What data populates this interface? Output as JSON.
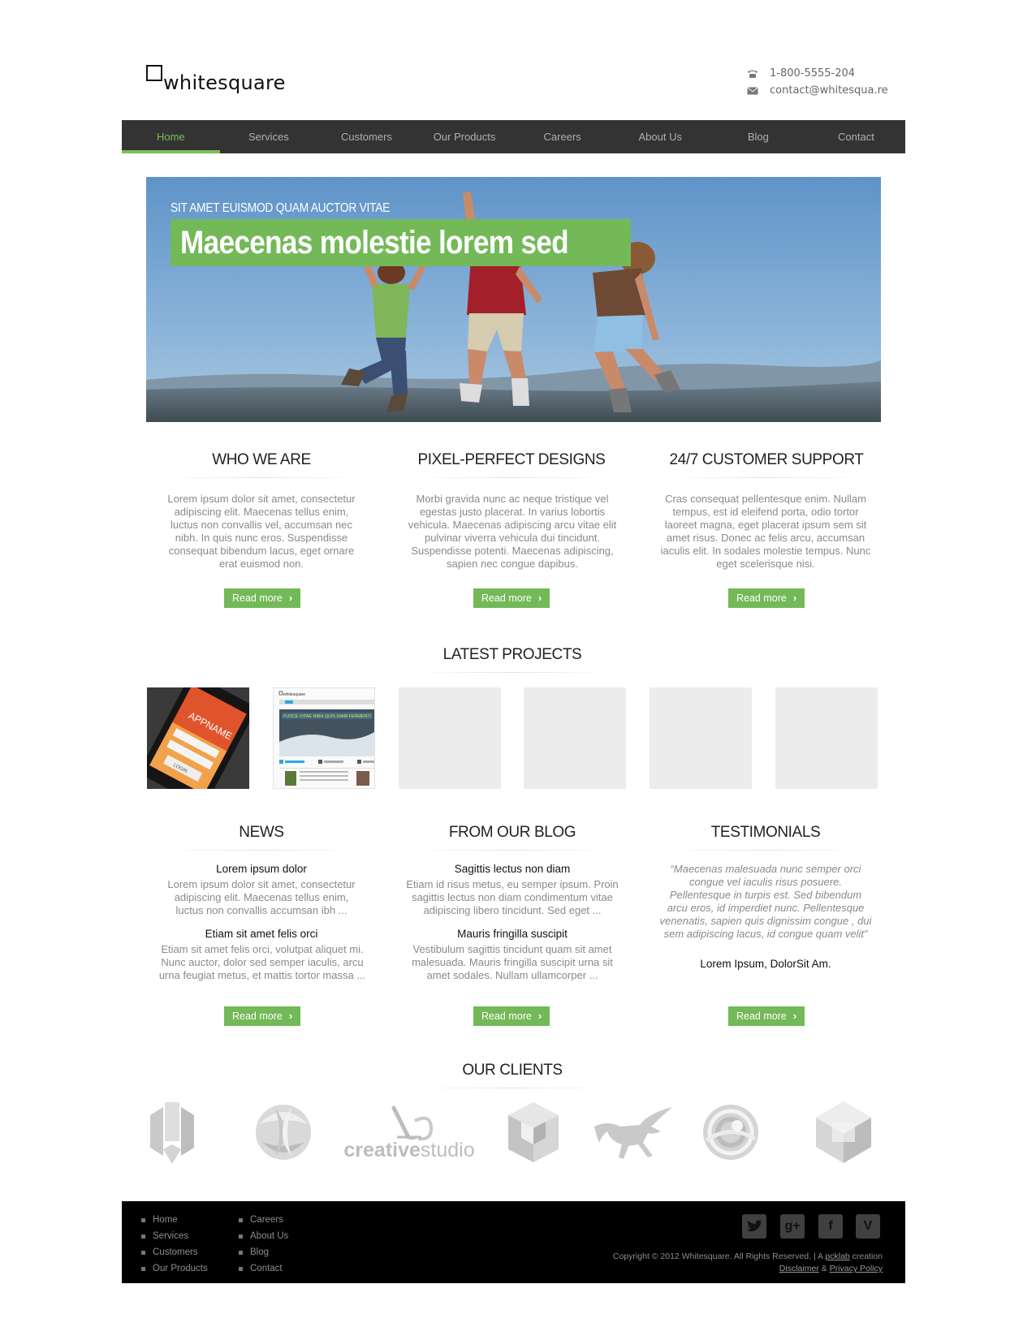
{
  "brand": {
    "name": "whitesquare"
  },
  "contact": {
    "phone": "1-800-5555-204",
    "email": "contact@whitesqua.re",
    "phone_icon": "phone-icon",
    "email_icon": "envelope-icon"
  },
  "nav": {
    "items": [
      {
        "label": "Home",
        "active": true
      },
      {
        "label": "Services"
      },
      {
        "label": "Customers"
      },
      {
        "label": "Our Products"
      },
      {
        "label": "Careers"
      },
      {
        "label": "About Us"
      },
      {
        "label": "Blog"
      },
      {
        "label": "Contact"
      }
    ]
  },
  "hero": {
    "subtitle": "SIT AMET EUISMOD QUAM AUCTOR VITAE",
    "title": "Maecenas molestie lorem sed"
  },
  "features": [
    {
      "title": "WHO WE ARE",
      "text": "Lorem ipsum dolor sit amet, consectetur adipiscing elit. Maecenas tellus enim, luctus non convallis vel, accumsan nec nibh. In quis nunc eros. Suspendisse consequat bibendum lacus, eget ornare erat euismod non.",
      "button": "Read more"
    },
    {
      "title": "PIXEL-PERFECT DESIGNS",
      "text": "Morbi gravida nunc ac neque tristique vel egestas justo placerat. In varius lobortis vehicula. Maecenas adipiscing arcu vitae elit pulvinar viverra vehicula dui tincidunt. Suspendisse potenti. Maecenas adipiscing, sapien nec congue dapibus.",
      "button": "Read more"
    },
    {
      "title": "24/7 CUSTOMER SUPPORT",
      "text": "Cras consequat pellentesque enim. Nullam tempus, est id eleifend porta, odio tortor laoreet magna, eget placerat ipsum sem sit amet risus. Donec ac felis arcu, accumsan iaculis elit. In sodales molestie tempus. Nunc eget scelerisque nisi.",
      "button": "Read more"
    }
  ],
  "projects": {
    "title": "LATEST PROJECTS",
    "thumb1": {
      "screen_text": "APPNAME",
      "login": "LOGIN"
    },
    "thumb2": {
      "brand": "whitesquare",
      "banner": "FUSCE VITAE NIBH QUIS DIAM FERMENTI"
    }
  },
  "news": {
    "title": "NEWS",
    "items": [
      {
        "title": "Lorem ipsum dolor",
        "text": "Lorem ipsum dolor sit amet, consectetur adipiscing elit. Maecenas tellus enim, luctus non convallis accumsan ibh ..."
      },
      {
        "title": "Etiam sit amet felis orci",
        "text": "Etiam sit amet felis orci, volutpat aliquet mi. Nunc auctor, dolor sed semper iaculis, arcu urna feugiat metus, et mattis tortor massa ..."
      }
    ],
    "button": "Read more"
  },
  "blog": {
    "title": "FROM OUR BLOG",
    "items": [
      {
        "title": "Sagittis lectus non diam",
        "text": "Etiam id risus metus, eu semper ipsum. Proin sagittis lectus non diam condimentum vitae adipiscing libero tincidunt. Sed eget ..."
      },
      {
        "title": "Mauris fringilla suscipit",
        "text": "Vestibulum sagittis tincidunt quam sit amet malesuada. Mauris fringilla suscipit urna sit amet sodales. Nullam ullamcorper ..."
      }
    ],
    "button": "Read more"
  },
  "testimonials": {
    "title": "TESTIMONIALS",
    "quote": "“Maecenas malesuada nunc semper orci congue vel iaculis risus posuere. Pellentesque in turpis est. Sed bibendum arcu eros, id imperdiet nunc. Pellentesque venenatis, sapien quis dignissim congue , dui sem adipiscing lacus, id congue quam velit”",
    "author": "Lorem Ipsum, DolorSit Am.",
    "button": "Read more"
  },
  "clients": {
    "title": "OUR CLIENTS",
    "creative_bold": "creative",
    "creative_light": "studio"
  },
  "footer": {
    "col1": [
      "Home",
      "Services",
      "Customers",
      "Our Products"
    ],
    "col2": [
      "Careers",
      "About Us",
      "Blog",
      "Contact"
    ],
    "social": [
      {
        "icon": "twitter-icon"
      },
      {
        "icon": "google-plus-icon",
        "glyph": "g+"
      },
      {
        "icon": "facebook-icon",
        "glyph": "f"
      },
      {
        "icon": "vimeo-icon",
        "glyph": "V"
      }
    ],
    "copyright": "Copyright © 2012 Whitesquare. All Rights Reserved. | A ",
    "pcklab": "pcklab",
    "creation": " creation",
    "disclaimer": "Disclaimer",
    "amp": " & ",
    "privacy": "Privacy Policy"
  },
  "colors": {
    "accent": "#73b957",
    "nav_bg": "#333333",
    "footer_bg": "#000000",
    "text_muted": "#8a8a8a"
  }
}
